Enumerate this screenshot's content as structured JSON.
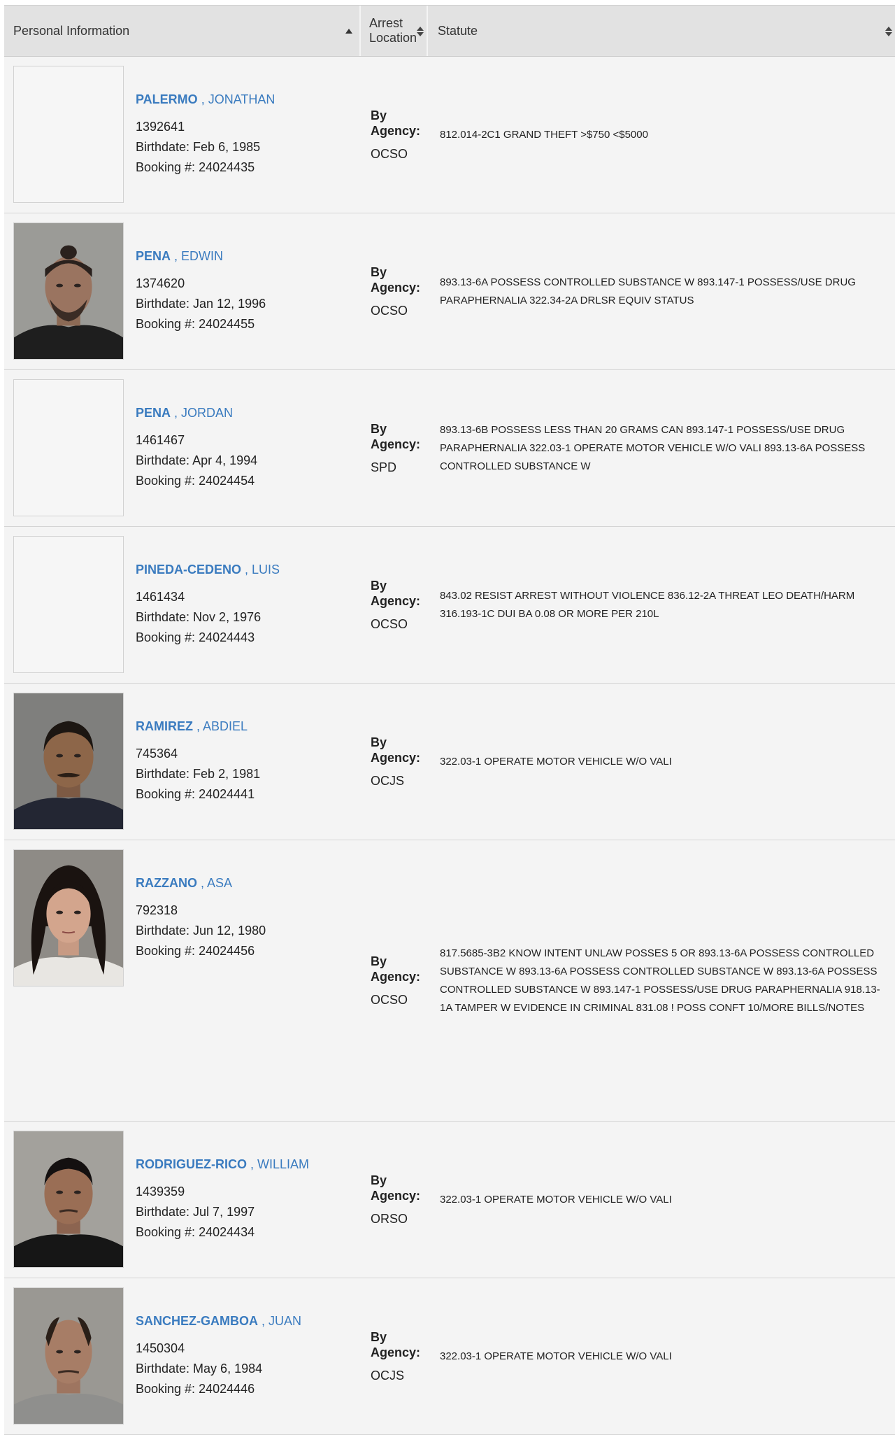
{
  "header": {
    "personal_information": "Personal Information",
    "arrest_location": "Arrest Location",
    "statute": "Statute"
  },
  "labels": {
    "birthdate_prefix": "Birthdate: ",
    "booking_prefix": "Booking #: ",
    "by_agency": "By Agency:"
  },
  "rows": [
    {
      "last": "PALERMO",
      "first": ", JONATHAN",
      "id": "1392641",
      "birthdate": "Feb 6, 1985",
      "booking": "24024435",
      "agency": "OCSO",
      "statute": "812.014-2C1 GRAND THEFT >$750 <$5000"
    },
    {
      "last": "PENA",
      "first": ", EDWIN",
      "id": "1374620",
      "birthdate": "Jan 12, 1996",
      "booking": "24024455",
      "agency": "OCSO",
      "statute": "893.13-6A POSSESS CONTROLLED SUBSTANCE W 893.147-1 POSSESS/USE DRUG PARAPHERNALIA 322.34-2A DRLSR EQUIV STATUS"
    },
    {
      "last": "PENA",
      "first": ", JORDAN",
      "id": "1461467",
      "birthdate": "Apr 4, 1994",
      "booking": "24024454",
      "agency": "SPD",
      "statute": "893.13-6B POSSESS LESS THAN 20 GRAMS CAN 893.147-1 POSSESS/USE DRUG PARAPHERNALIA 322.03-1 OPERATE MOTOR VEHICLE W/O VALI 893.13-6A POSSESS CONTROLLED SUBSTANCE W"
    },
    {
      "last": "PINEDA-CEDENO",
      "first": ", LUIS",
      "id": "1461434",
      "birthdate": "Nov 2, 1976",
      "booking": "24024443",
      "agency": "OCSO",
      "statute": "843.02 RESIST ARREST WITHOUT VIOLENCE 836.12-2A THREAT LEO DEATH/HARM 316.193-1C DUI BA 0.08 OR MORE PER 210L"
    },
    {
      "last": "RAMIREZ",
      "first": ", ABDIEL",
      "id": "745364",
      "birthdate": "Feb 2, 1981",
      "booking": "24024441",
      "agency": "OCJS",
      "statute": "322.03-1 OPERATE MOTOR VEHICLE W/O VALI"
    },
    {
      "last": "RAZZANO",
      "first": ", ASA",
      "id": "792318",
      "birthdate": "Jun 12, 1980",
      "booking": "24024456",
      "agency": "OCSO",
      "statute": "817.5685-3B2 KNOW INTENT UNLAW POSSES 5 OR 893.13-6A POSSESS CONTROLLED SUBSTANCE W 893.13-6A POSSESS CONTROLLED SUBSTANCE W 893.13-6A POSSESS CONTROLLED SUBSTANCE W 893.147-1 POSSESS/USE DRUG PARAPHERNALIA 918.13-1A TAMPER W EVIDENCE IN CRIMINAL 831.08 ! POSS CONFT 10/MORE BILLS/NOTES"
    },
    {
      "last": "RODRIGUEZ-RICO",
      "first": ", WILLIAM",
      "id": "1439359",
      "birthdate": "Jul 7, 1997",
      "booking": "24024434",
      "agency": "ORSO",
      "statute": "322.03-1 OPERATE MOTOR VEHICLE W/O VALI"
    },
    {
      "last": "SANCHEZ-GAMBOA",
      "first": ", JUAN",
      "id": "1450304",
      "birthdate": "May 6, 1984",
      "booking": "24024446",
      "agency": "OCJS",
      "statute": "322.03-1 OPERATE MOTOR VEHICLE W/O VALI"
    }
  ]
}
